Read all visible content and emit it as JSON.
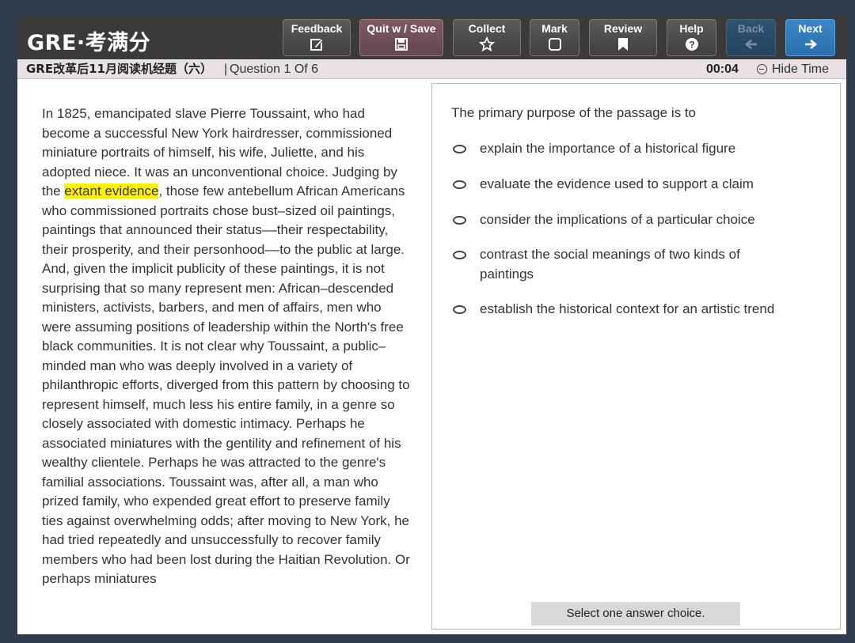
{
  "brand": {
    "text": "GRE·考满分"
  },
  "toolbar": {
    "feedback": {
      "label": "Feedback",
      "icon": "edit-icon"
    },
    "quit": {
      "label": "Quit w / Save",
      "icon": "save-icon"
    },
    "collect": {
      "label": "Collect",
      "icon": "star-icon"
    },
    "mark": {
      "label": "Mark",
      "icon": "checkbox-icon"
    },
    "review": {
      "label": "Review",
      "icon": "bookmark-icon"
    },
    "help": {
      "label": "Help",
      "icon": "help-icon"
    },
    "back": {
      "label": "Back",
      "icon": "arrow-left-icon"
    },
    "next": {
      "label": "Next",
      "icon": "arrow-right-icon"
    }
  },
  "subbar": {
    "title": "GRE改革后11月阅读机经题（六）",
    "separator": "|",
    "question_count": "Question 1 Of 6",
    "time": "00:04",
    "hide_time": "Hide Time"
  },
  "passage": {
    "before": "In 1825, emancipated slave Pierre Toussaint, who had become a successful New York hairdresser, commissioned miniature portraits of himself, his wife, Juliette, and his adopted niece. It was an unconventional choice. Judging by the ",
    "highlight": "extant evidence",
    "after": ", those few antebellum African Americans who commissioned portraits chose bust–sized oil paintings, paintings that announced their status––their respectability, their prosperity, and their personhood––to the public at large. And, given the implicit publicity of these paintings, it is not surprising that so many represent men: African–descended ministers, activists, barbers, and men of affairs, men who were assuming positions of leadership within the North's free black communities. It is not clear why Toussaint, a public–minded man who was deeply involved in a variety of philanthropic efforts, diverged from this pattern by choosing to represent himself, much less his entire family, in a genre so closely associated with domestic intimacy. Perhaps he associated miniatures with the gentility and refinement of his wealthy clientele. Perhaps he was attracted to the genre's familial associations. Toussaint was, after all, a man who prized family, who expended great effort to preserve family ties against overwhelming odds; after moving to New York, he had tried repeatedly and unsuccessfully to recover family members who had been lost during the Haitian Revolution. Or perhaps miniatures"
  },
  "question": {
    "stem": "The primary purpose of the passage is to",
    "choices": [
      {
        "label": "explain the importance of a historical figure"
      },
      {
        "label": "evaluate the evidence used to support a claim"
      },
      {
        "label": "consider the implications of a particular choice"
      },
      {
        "label": "contrast the social meanings of two kinds of paintings"
      },
      {
        "label": "establish the historical context for an artistic trend"
      }
    ],
    "instruction": "Select one answer choice."
  }
}
